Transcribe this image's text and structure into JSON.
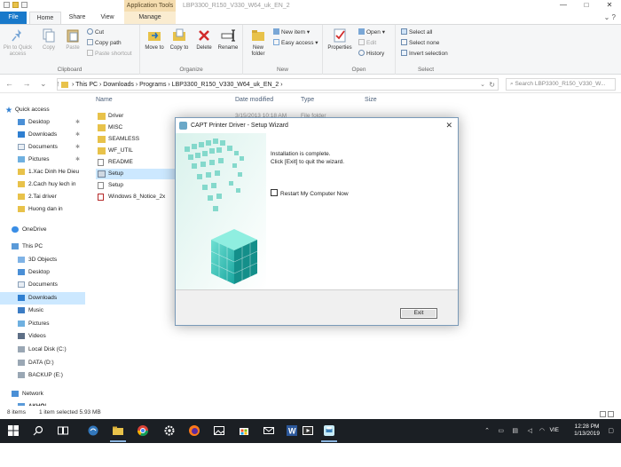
{
  "window": {
    "context_tab": "Application Tools",
    "path_title": "LBP3300_R150_V330_W64_uk_EN_2",
    "controls": [
      "—",
      "□",
      "✕"
    ]
  },
  "ribbon_tabs": [
    "File",
    "Home",
    "Share",
    "View",
    "Manage"
  ],
  "ribbon": {
    "clipboard": {
      "group": "Clipboard",
      "pin": "Pin to Quick access",
      "copy": "Copy",
      "paste": "Paste",
      "cut": "Cut",
      "copy_path": "Copy path",
      "paste_shortcut": "Paste shortcut"
    },
    "organize": {
      "group": "Organize",
      "move_to": "Move to",
      "copy_to": "Copy to",
      "delete": "Delete",
      "rename": "Rename"
    },
    "new": {
      "group": "New",
      "new_folder": "New folder",
      "new_item": "New item",
      "easy_access": "Easy access"
    },
    "open": {
      "group": "Open",
      "properties": "Properties",
      "open": "Open",
      "edit": "Edit",
      "history": "History"
    },
    "select": {
      "group": "Select",
      "select_all": "Select all",
      "select_none": "Select none",
      "invert": "Invert selection"
    }
  },
  "address": {
    "nav": "← → ⌄ ↑",
    "crumbs": "› This PC  ›  Downloads  ›  Programs  ›  LBP3300_R150_V330_W64_uk_EN_2  ›",
    "search_placeholder": "Search LBP3300_R150_V330_W..."
  },
  "nav_pane": {
    "quick_access": "Quick access",
    "items": [
      {
        "label": "Desktop",
        "pin": true
      },
      {
        "label": "Downloads",
        "pin": true
      },
      {
        "label": "Documents",
        "pin": true
      },
      {
        "label": "Pictures",
        "pin": true
      },
      {
        "label": "1.Xac Dinh He Dieu"
      },
      {
        "label": "2.Cach huy lech in"
      },
      {
        "label": "2.Tai driver"
      },
      {
        "label": "Huong dan in"
      }
    ],
    "onedrive": "OneDrive",
    "this_pc": "This PC",
    "pc_items": [
      "3D Objects",
      "Desktop",
      "Documents",
      "Downloads",
      "Music",
      "Pictures",
      "Videos",
      "Local Disk (C:)",
      "DATA (D:)",
      "BACKUP (E:)"
    ],
    "network": "Network",
    "network_items": [
      "AKHOI"
    ]
  },
  "file_list": {
    "columns": [
      "Name",
      "Date modified",
      "Type",
      "Size"
    ],
    "files": [
      {
        "name": "Driver",
        "kind": "folder"
      },
      {
        "name": "MISC",
        "kind": "folder"
      },
      {
        "name": "SEAMLESS",
        "kind": "folder"
      },
      {
        "name": "WF_UTIL",
        "kind": "folder"
      },
      {
        "name": "README",
        "kind": "doc"
      },
      {
        "name": "Setup",
        "kind": "app"
      },
      {
        "name": "Setup",
        "kind": "doc"
      },
      {
        "name": "Windows 8_Notice_2x",
        "kind": "pdf"
      }
    ],
    "first_row_date": "3/15/2013 10:18 AM",
    "first_row_type": "File folder"
  },
  "dialog": {
    "title": "CAPT Printer Driver - Setup Wizard",
    "close": "✕",
    "message_1": "Installation is complete.",
    "message_2": "Click [Exit] to quit the wizard.",
    "checkbox_label": "Restart My Computer Now",
    "exit_button": "Exit"
  },
  "status": {
    "items": "8 items",
    "selection": "1 item selected  5.93 MB"
  },
  "tray": {
    "lang": "VIE",
    "time": "12:28 PM",
    "date": "1/13/2019"
  },
  "colors": {
    "file_tab": "#1979ca",
    "context_tab": "#f5ddb0",
    "selection": "#cce8ff",
    "taskbar": "#1b1f24"
  }
}
